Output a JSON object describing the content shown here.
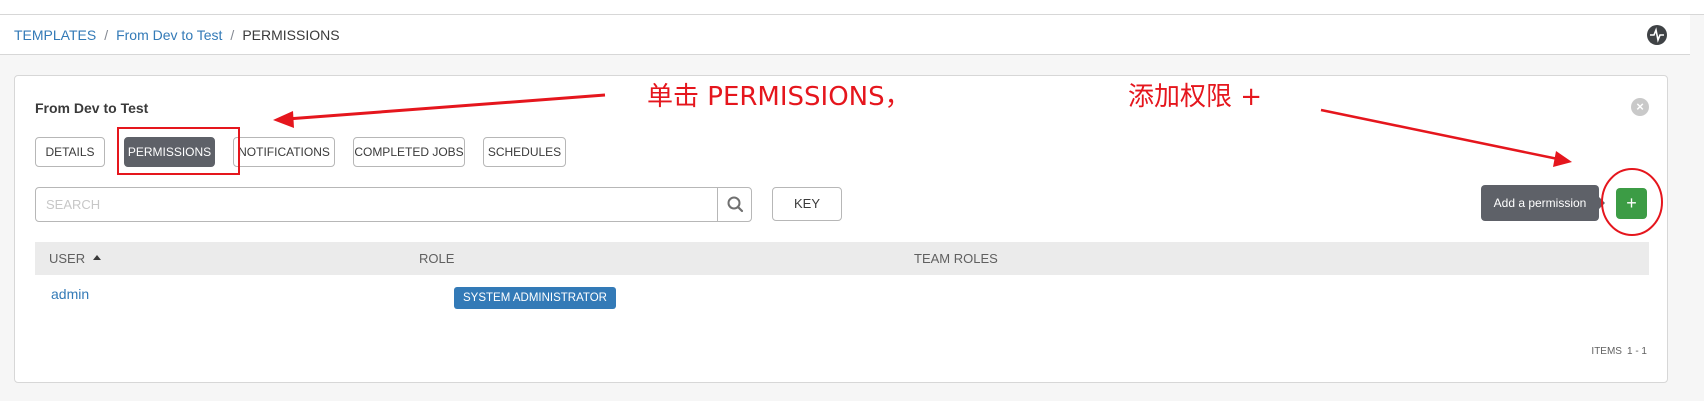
{
  "breadcrumb": {
    "templates": "TEMPLATES",
    "template": "From Dev to Test",
    "current": "PERMISSIONS",
    "separator": "/"
  },
  "panel": {
    "title": "From Dev to Test",
    "tabs": [
      "DETAILS",
      "PERMISSIONS",
      "NOTIFICATIONS",
      "COMPLETED JOBS",
      "SCHEDULES"
    ],
    "active_tab": "PERMISSIONS"
  },
  "search": {
    "placeholder": "SEARCH",
    "icon": "search-icon"
  },
  "key_button": "KEY",
  "add_tooltip": "Add a permission",
  "add_button_label": "+",
  "table": {
    "headers": [
      "USER",
      "ROLE",
      "TEAM ROLES"
    ],
    "rows": [
      {
        "user": "admin",
        "role": "SYSTEM ADMINISTRATOR",
        "team_roles": ""
      }
    ]
  },
  "pagination": {
    "label": "ITEMS",
    "range": "1 - 1"
  },
  "annotations": {
    "click_permissions": "单击 PERMISSIONS，",
    "add_permission": "添加权限 +"
  },
  "colors": {
    "link": "#337ab7",
    "active_tab": "#5e6168",
    "add_button": "#3c9c45",
    "annotation": "#e5161d"
  }
}
